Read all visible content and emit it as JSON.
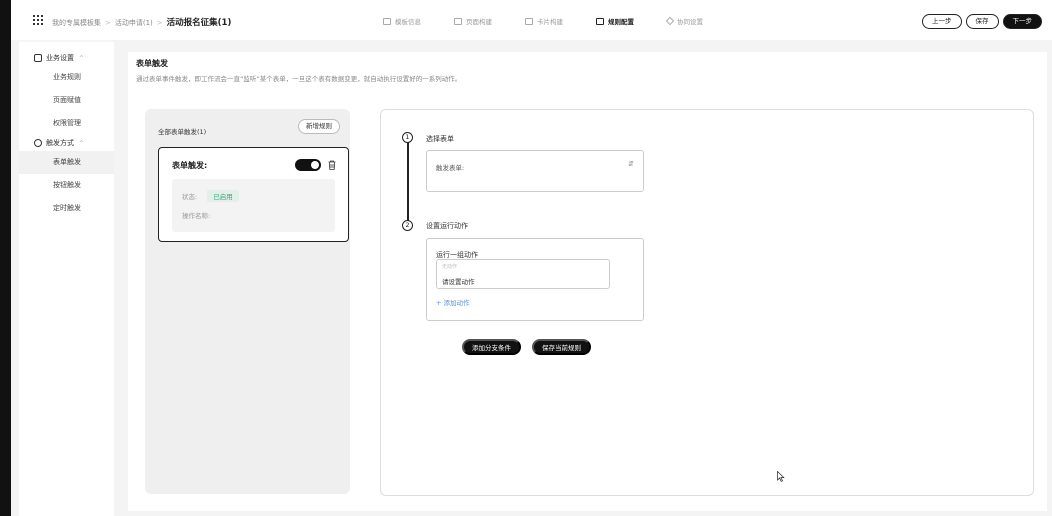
{
  "breadcrumb": {
    "items": [
      "我的专属模板集",
      "活动申请(1)"
    ],
    "current": "活动报名征集(1)"
  },
  "steps": [
    {
      "label": "模板信息",
      "icon": "template-icon",
      "active": false
    },
    {
      "label": "页面构建",
      "icon": "page-icon",
      "active": false
    },
    {
      "label": "卡片构建",
      "icon": "card-icon",
      "active": false
    },
    {
      "label": "规则配置",
      "icon": "rule-icon",
      "active": true
    },
    {
      "label": "协同设置",
      "icon": "collab-icon",
      "active": false
    }
  ],
  "toolbar": {
    "prev": "上一步",
    "save": "保存",
    "next": "下一步"
  },
  "sidebar": {
    "group1": "业务设置",
    "group1_items": [
      "业务规则",
      "页面赋值",
      "权限管理"
    ],
    "group2": "触发方式",
    "group2_items": [
      "表单触发",
      "按钮触发",
      "定时触发"
    ],
    "active_item": "表单触发"
  },
  "main": {
    "title": "表单触发",
    "description": "通过表单事件触发，即工作流会一直“监听”某个表单，一旦这个表有数据变更，就自动执行设置好的一系列动作。"
  },
  "left_panel": {
    "heading": "全部表单触发(1)",
    "add_button": "新增规则",
    "rule": {
      "title": "表单触发:",
      "enabled": true,
      "status_label": "状态:",
      "status_value": "已启用",
      "op_label": "操作名称:"
    }
  },
  "right_panel": {
    "step1": {
      "num": "1",
      "label": "选择表单",
      "field_label": "触发表单:"
    },
    "step2": {
      "num": "2",
      "label": "设置运行动作",
      "group_title": "运行一组动作",
      "action_hint": "无动作",
      "action_value": "请设置动作",
      "add_action": "+ 添加动作"
    },
    "branch_button": "添加分支条件",
    "save_rule_button": "保存当前规则"
  }
}
